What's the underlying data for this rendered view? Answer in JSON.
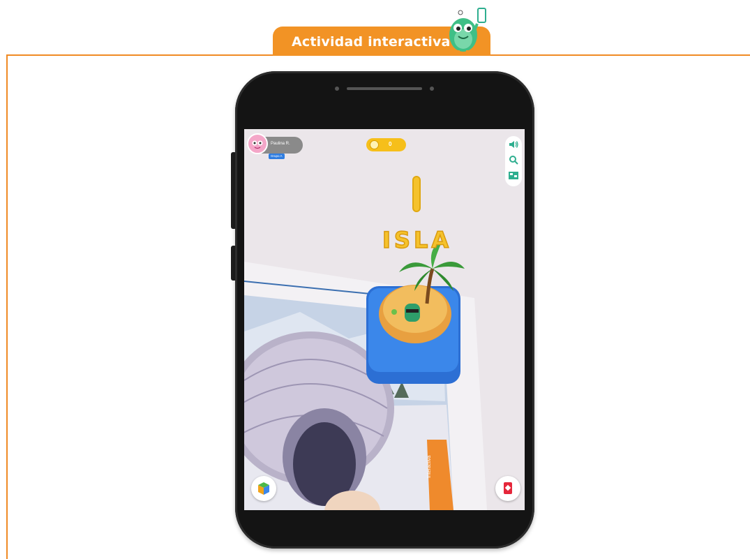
{
  "header": {
    "tab_label": "Actividad interactiva",
    "accent_color": "#f29325",
    "mascot_icon": "green-monster-with-phone-icon"
  },
  "app": {
    "user": {
      "name": "Paulina R.",
      "group": "Grupo A"
    },
    "coins": "0",
    "tools": [
      {
        "icon": "speaker-icon"
      },
      {
        "icon": "search-icon"
      },
      {
        "icon": "map-icon"
      }
    ],
    "ar_scene": {
      "letter": "I",
      "word": "ISLA"
    },
    "bottom_left_button_icon": "cube-icon",
    "bottom_right_button_icon": "card-icon",
    "book_strip_text": "Interactiva"
  }
}
